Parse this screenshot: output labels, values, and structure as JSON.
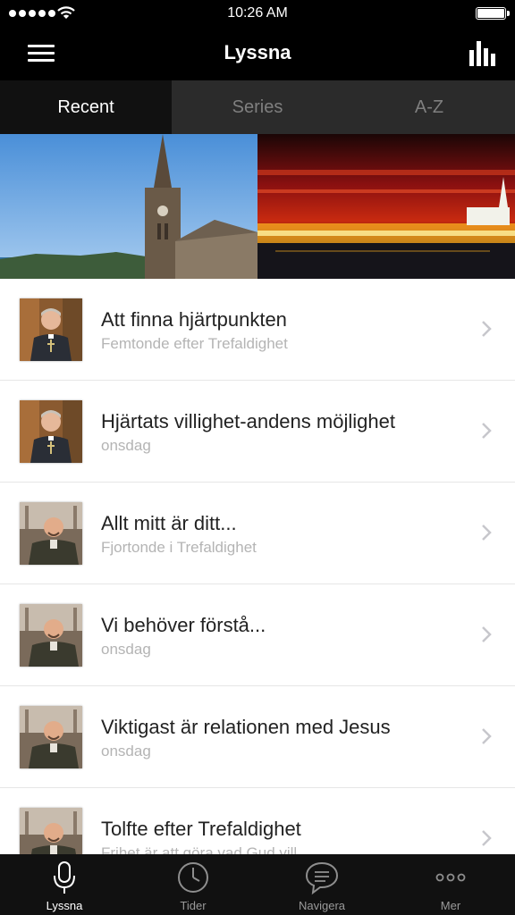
{
  "status_bar": {
    "time": "10:26 AM"
  },
  "nav_bar": {
    "title": "Lyssna"
  },
  "tabs": [
    {
      "label": "Recent",
      "active": true
    },
    {
      "label": "Series",
      "active": false
    },
    {
      "label": "A-Z",
      "active": false
    }
  ],
  "sermons": [
    {
      "title": "Att finna hjärtpunkten",
      "subtitle": "Femtonde efter Trefaldighet"
    },
    {
      "title": "Hjärtats villighet-andens möjlighet",
      "subtitle": "onsdag"
    },
    {
      "title": "Allt mitt är ditt...",
      "subtitle": "Fjortonde i Trefaldighet"
    },
    {
      "title": "Vi behöver förstå...",
      "subtitle": "onsdag"
    },
    {
      "title": "Viktigast är relationen med Jesus",
      "subtitle": "onsdag"
    },
    {
      "title": "Tolfte efter Trefaldighet",
      "subtitle": "Frihet är att göra vad Gud vill"
    }
  ],
  "tab_bar": [
    {
      "label": "Lyssna",
      "icon": "microphone-icon",
      "active": true
    },
    {
      "label": "Tider",
      "icon": "clock-icon",
      "active": false
    },
    {
      "label": "Navigera",
      "icon": "speech-bubble-icon",
      "active": false
    },
    {
      "label": "Mer",
      "icon": "more-dots-icon",
      "active": false
    }
  ],
  "colors": {
    "bar_background": "#000000",
    "tab_strip": "#2b2b2b",
    "active_tab": "#111111",
    "subtitle": "#b4b4b4"
  }
}
